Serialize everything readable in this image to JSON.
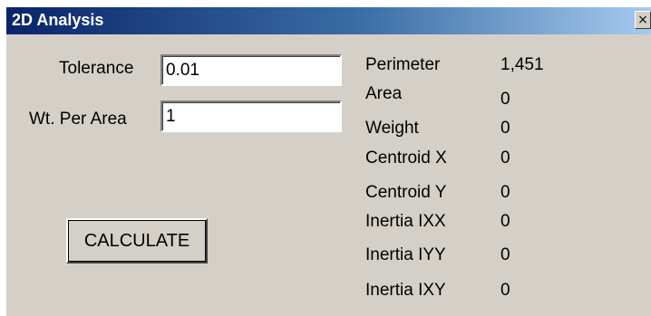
{
  "window": {
    "title": "2D Analysis",
    "close_glyph": "×",
    "close_icon": "close-icon"
  },
  "inputs": {
    "tolerance_label": "Tolerance",
    "tolerance_value": "0.01",
    "weight_label": "Wt. Per Area",
    "weight_value": "1"
  },
  "actions": {
    "calculate_label": "CALCULATE"
  },
  "results": [
    {
      "label": "Perimeter",
      "value": "1,451"
    },
    {
      "label": "Area",
      "value": "0"
    },
    {
      "label": "Weight",
      "value": "0"
    },
    {
      "label": "Centroid X",
      "value": "0"
    },
    {
      "label": "Centroid Y",
      "value": "0"
    },
    {
      "label": "Inertia IXX",
      "value": "0"
    },
    {
      "label": "Inertia IYY",
      "value": "0"
    },
    {
      "label": "Inertia IXY",
      "value": "0"
    }
  ]
}
